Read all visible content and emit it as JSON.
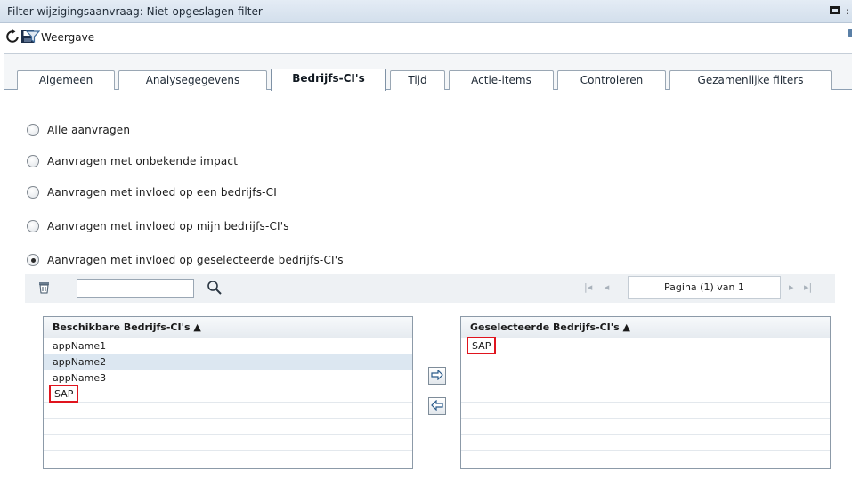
{
  "window": {
    "title": "Filter wijzigingsaanvraag: Niet-opgeslagen filter",
    "title_suffix": ":"
  },
  "toolbar": {
    "refresh_icon": "refresh-icon",
    "save_icon": "save-icon",
    "filter_icon": "filter-icon",
    "view_label": "Weergave"
  },
  "tabs": [
    {
      "label": "Algemeen"
    },
    {
      "label": "Analysegegevens"
    },
    {
      "label": "Bedrijfs-CI's"
    },
    {
      "label": "Tijd"
    },
    {
      "label": "Actie-items"
    },
    {
      "label": "Controleren"
    },
    {
      "label": "Gezamenlijke filters"
    }
  ],
  "active_tab": "Bedrijfs-CI's",
  "radios": [
    {
      "label": "Alle aanvragen",
      "checked": false
    },
    {
      "label": "Aanvragen met onbekende impact",
      "checked": false
    },
    {
      "label": "Aanvragen met invloed op een bedrijfs-CI",
      "checked": false
    },
    {
      "label": "Aanvragen met invloed op mijn bedrijfs-CI's",
      "checked": false
    },
    {
      "label": "Aanvragen met invloed op geselecteerde bedrijfs-CI's",
      "checked": true
    }
  ],
  "search": {
    "value": "",
    "placeholder": ""
  },
  "pager": {
    "page_text": "Pagina (1) van 1",
    "first": "|◂",
    "prev": "◂",
    "next": "▸",
    "last": "▸|"
  },
  "available": {
    "header": "Beschikbare Bedrijfs-CI's ▲",
    "rows": [
      "appName1",
      "appName2",
      "appName3",
      "SAP",
      "",
      "",
      ""
    ],
    "selected_row": 1,
    "highlighted_row": 3
  },
  "selected": {
    "header": "Geselecteerde Bedrijfs-CI's ▲",
    "rows": [
      "SAP",
      "",
      "",
      "",
      "",
      "",
      ""
    ],
    "highlighted_row": 0
  },
  "buttons": {
    "add_icon": "arrow-right-icon",
    "remove_icon": "arrow-left-icon"
  },
  "colors": {
    "highlight": "#e0141e",
    "selected_row": "#dce7f1",
    "tab_border": "#9aa7b4"
  }
}
